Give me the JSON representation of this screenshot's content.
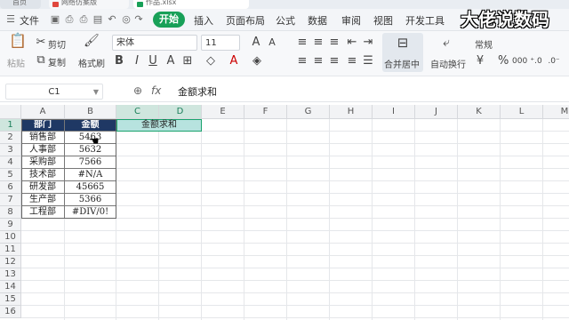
{
  "tabs": [
    {
      "label": "首页"
    },
    {
      "label": "网络仿案版"
    },
    {
      "label": "作品.xlsx"
    }
  ],
  "menu": {
    "file": "文件",
    "items": [
      "开始",
      "插入",
      "页面布局",
      "公式",
      "数据",
      "审阅",
      "视图",
      "开发工具"
    ],
    "active": "开始"
  },
  "ribbon": {
    "paste": "粘贴",
    "cut": "剪切",
    "copy": "复制",
    "format_painter": "格式刷",
    "font_name": "宋体",
    "font_size": "11",
    "merge_center": "合并居中",
    "wrap_text": "自动换行",
    "number_format": "常规"
  },
  "formula_bar": {
    "name_box": "C1",
    "content": "金额求和"
  },
  "columns": [
    "A",
    "B",
    "C",
    "D",
    "E",
    "F",
    "G",
    "H",
    "I",
    "J",
    "K",
    "L",
    "M"
  ],
  "rows": [
    "1",
    "2",
    "3",
    "4",
    "5",
    "6",
    "7",
    "8",
    "9",
    "10",
    "11",
    "12",
    "13",
    "14",
    "15",
    "16"
  ],
  "table": {
    "headers": [
      "部门",
      "金额"
    ],
    "rows": [
      [
        "销售部",
        "5463"
      ],
      [
        "人事部",
        "5632"
      ],
      [
        "采购部",
        "7566"
      ],
      [
        "技术部",
        "#N/A"
      ],
      [
        "研发部",
        "45665"
      ],
      [
        "生产部",
        "5366"
      ],
      [
        "工程部",
        "#DIV/0!"
      ]
    ]
  },
  "merged_cell": "金额求和",
  "watermark": "大佬说数码"
}
